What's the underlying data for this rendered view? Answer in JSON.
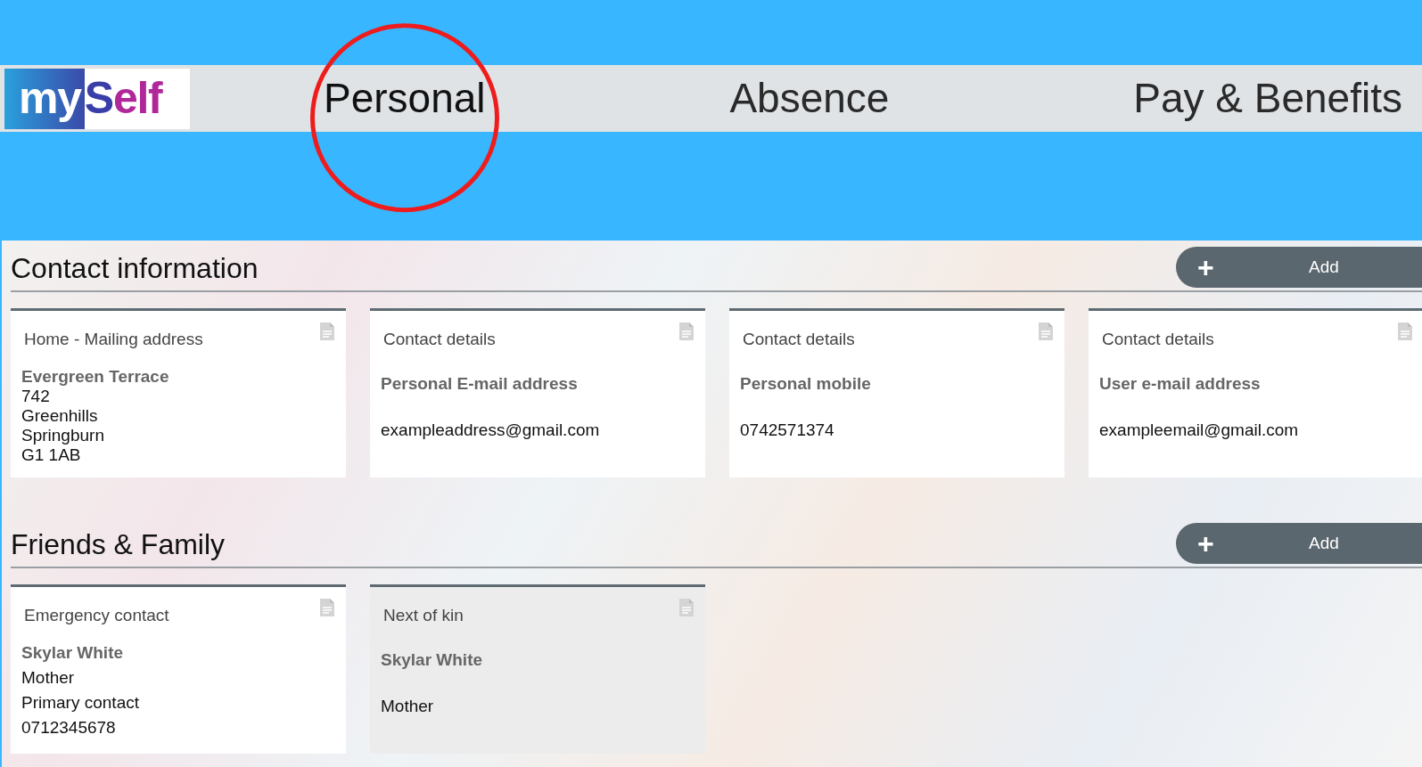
{
  "logo": {
    "parts": [
      "my",
      "S",
      "elf"
    ]
  },
  "nav": [
    {
      "label": "Personal",
      "selected": true
    },
    {
      "label": "Absence",
      "selected": false
    },
    {
      "label": "Pay & Benefits",
      "selected": false
    }
  ],
  "sections": [
    {
      "title": "Contact information",
      "button": {
        "icon": "+",
        "label": "Add"
      },
      "cards": [
        {
          "title": "Home - Mailing address",
          "compact": true,
          "shaded": false,
          "lines": [
            {
              "kind": "label",
              "text": "Evergreen Terrace"
            },
            {
              "kind": "value",
              "text": "742"
            },
            {
              "kind": "value",
              "text": "Greenhills"
            },
            {
              "kind": "value",
              "text": "Springburn"
            },
            {
              "kind": "value",
              "text": "G1 1AB"
            }
          ]
        },
        {
          "title": "Contact details",
          "compact": false,
          "shaded": false,
          "lines": [
            {
              "kind": "label",
              "text": "Personal E-mail address"
            },
            {
              "kind": "value",
              "text": "exampleaddress@gmail.com"
            }
          ]
        },
        {
          "title": "Contact details",
          "compact": false,
          "shaded": false,
          "lines": [
            {
              "kind": "label",
              "text": "Personal mobile"
            },
            {
              "kind": "value",
              "text": "0742571374"
            }
          ]
        },
        {
          "title": "Contact details",
          "compact": false,
          "shaded": false,
          "lines": [
            {
              "kind": "label",
              "text": "User e-mail address"
            },
            {
              "kind": "value",
              "text": "exampleemail@gmail.com"
            }
          ]
        }
      ]
    },
    {
      "title": "Friends & Family",
      "button": {
        "icon": "+",
        "label": "Add"
      },
      "cards": [
        {
          "title": "Emergency contact",
          "compact": true,
          "shaded": false,
          "lines": [
            {
              "kind": "label",
              "text": "Skylar White"
            },
            {
              "kind": "value",
              "text": "Mother"
            },
            {
              "kind": "value",
              "text": "Primary contact"
            },
            {
              "kind": "value",
              "text": "0712345678"
            }
          ]
        },
        {
          "title": "Next of kin",
          "compact": false,
          "shaded": true,
          "lines": [
            {
              "kind": "label",
              "text": "Skylar White"
            },
            {
              "kind": "value",
              "text": "Mother"
            }
          ]
        }
      ]
    }
  ]
}
